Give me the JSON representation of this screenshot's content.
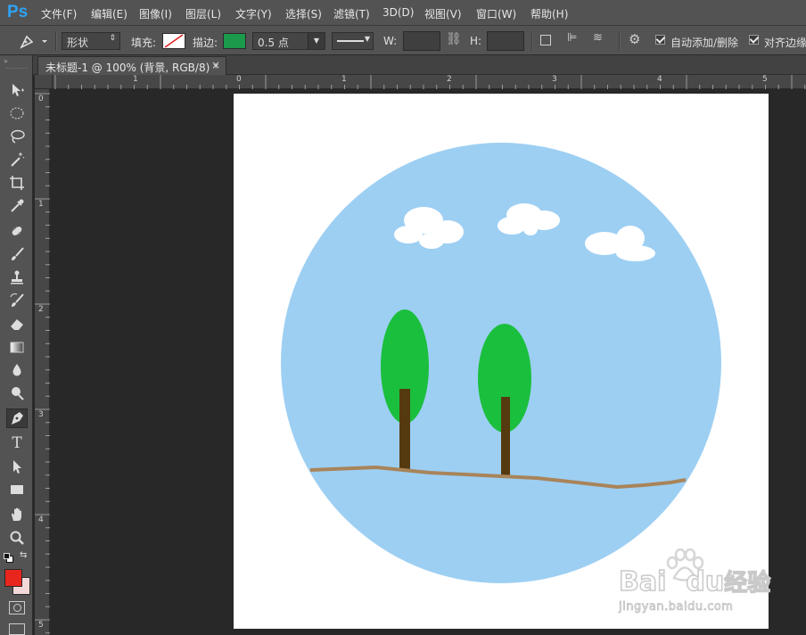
{
  "app": {
    "logo": "Ps"
  },
  "menu": [
    "文件(F)",
    "编辑(E)",
    "图像(I)",
    "图层(L)",
    "文字(Y)",
    "选择(S)",
    "滤镜(T)",
    "3D(D)",
    "视图(V)",
    "窗口(W)",
    "帮助(H)"
  ],
  "options": {
    "mode": "形状",
    "fill_label": "填充:",
    "stroke_label": "描边:",
    "stroke_color": "#1a9a4a",
    "stroke_width": "0.5 点",
    "w_label": "W:",
    "h_label": "H:",
    "auto_add_delete": "自动添加/删除",
    "align_edges": "对齐边缘"
  },
  "tab": {
    "title": "未标题-1 @ 100% (背景, RGB/8) *",
    "close": "×"
  },
  "ruler": {
    "h_labels": [
      "1",
      "0",
      "1",
      "2",
      "3",
      "4",
      "5"
    ],
    "v_labels": [
      "0",
      "1",
      "2",
      "3",
      "4",
      "5"
    ]
  },
  "tools": [
    "move-tool",
    "marquee-tool",
    "lasso-tool",
    "magic-wand-tool",
    "crop-tool",
    "eyedropper-tool",
    "healing-brush-tool",
    "brush-tool",
    "clone-stamp-tool",
    "history-brush-tool",
    "eraser-tool",
    "gradient-tool",
    "blur-tool",
    "dodge-tool",
    "pen-tool",
    "type-tool",
    "path-selection-tool",
    "rectangle-tool",
    "hand-tool",
    "zoom-tool"
  ],
  "colors": {
    "foreground": "#e8261d",
    "background": "#f2d8d8",
    "sky": "#9dcff3",
    "tree": "#1bbf3e",
    "trunk": "#553a10",
    "ground": "#a8845a",
    "accent": "#2fa3f6"
  },
  "watermark": {
    "brand": "Bai",
    "brand2": "du",
    "brand_cn": "经验",
    "url": "jingyan.baidu.com"
  }
}
